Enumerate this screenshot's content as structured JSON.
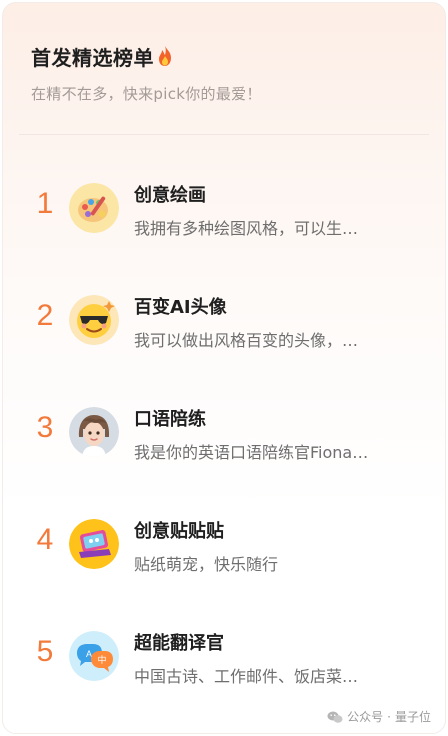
{
  "header": {
    "title": "首发精选榜单",
    "subtitle": "在精不在多，快来pick你的最爱！"
  },
  "items": [
    {
      "rank": "1",
      "name": "创意绘画",
      "desc": "我拥有多种绘图风格，可以生…",
      "icon": "palette-icon"
    },
    {
      "rank": "2",
      "name": "百变AI头像",
      "desc": "我可以做出风格百变的头像，…",
      "icon": "cool-face-icon"
    },
    {
      "rank": "3",
      "name": "口语陪练",
      "desc": "我是你的英语口语陪练官Fiona…",
      "icon": "girl-avatar-icon"
    },
    {
      "rank": "4",
      "name": "创意贴贴贴",
      "desc": "贴纸萌宠，快乐随行",
      "icon": "sticker-laptop-icon"
    },
    {
      "rank": "5",
      "name": "超能翻译官",
      "desc": "中国古诗、工作邮件、饭店菜…",
      "icon": "translate-bubbles-icon"
    }
  ],
  "footer": {
    "source": "公众号",
    "separator": "·",
    "account": "量子位"
  },
  "colors": {
    "rank": "#f27a3a",
    "title": "#1f1f1f",
    "subtitle": "#a49a96"
  }
}
